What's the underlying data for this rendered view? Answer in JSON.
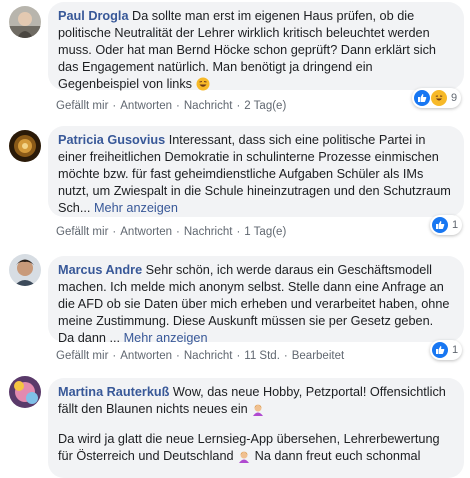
{
  "comments": [
    {
      "author": "Paul Drogla",
      "text": "Da sollte man erst im eigenen Haus prüfen, ob die politische Neutralität der Lehrer wirklich kritisch beleuchtet werden muss. Oder hat man Bernd Höcke schon geprüft? Dann erklärt sich das Engagement natürlich. Man benötigt ja dringend ein Gegenbeispiel von links",
      "more": "",
      "like": "Gefällt mir",
      "reply": "Antworten",
      "message": "Nachricht",
      "time": "2 Tag(e)",
      "edited": "",
      "reaction_count": "9",
      "reactions": [
        "like-icon",
        "haha-icon"
      ]
    },
    {
      "author": "Patricia Gusovius",
      "text": "Interessant, dass sich eine politische Partei in einer freiheitlichen Demokratie in schulinterne Prozesse einmischen möchte bzw. für fast geheimdienstliche Aufgaben Schüler als IMs nutzt, um Zwiespalt in die Schule hineinzutragen und den Schutzraum Sch...",
      "more": "Mehr anzeigen",
      "like": "Gefällt mir",
      "reply": "Antworten",
      "message": "Nachricht",
      "time": "1 Tag(e)",
      "edited": "",
      "reaction_count": "1",
      "reactions": [
        "like-icon"
      ]
    },
    {
      "author": "Marcus Andre",
      "text": "Sehr schön, ich werde daraus ein Geschäftsmodell machen. Ich melde mich anonym selbst. Stelle dann eine Anfrage an die AFD ob sie Daten über mich erheben und verarbeitet haben, ohne meine Zustimmung. Diese Auskunft müssen sie per Gesetz geben. Da dann ...",
      "more": "Mehr anzeigen",
      "like": "Gefällt mir",
      "reply": "Antworten",
      "message": "Nachricht",
      "time": "11 Std.",
      "edited": "Bearbeitet",
      "reaction_count": "1",
      "reactions": [
        "like-icon"
      ]
    },
    {
      "author": "Martina Rauterkuß",
      "text": "Wow, das neue Hobby, Petzportal! Offensichtlich fällt den Blaunen nichts neues ein",
      "text2": "Da wird ja glatt die neue Lernsieg-App übersehen, Lehrerbewertung für Österreich und Deutschland",
      "text2b": "Na dann freut euch schonmal",
      "more": ""
    }
  ],
  "colors": {
    "author": "#385898",
    "bubble": "#f2f3f5",
    "meta": "#606770",
    "like": "#1877f2",
    "haha": "#f7b928"
  }
}
